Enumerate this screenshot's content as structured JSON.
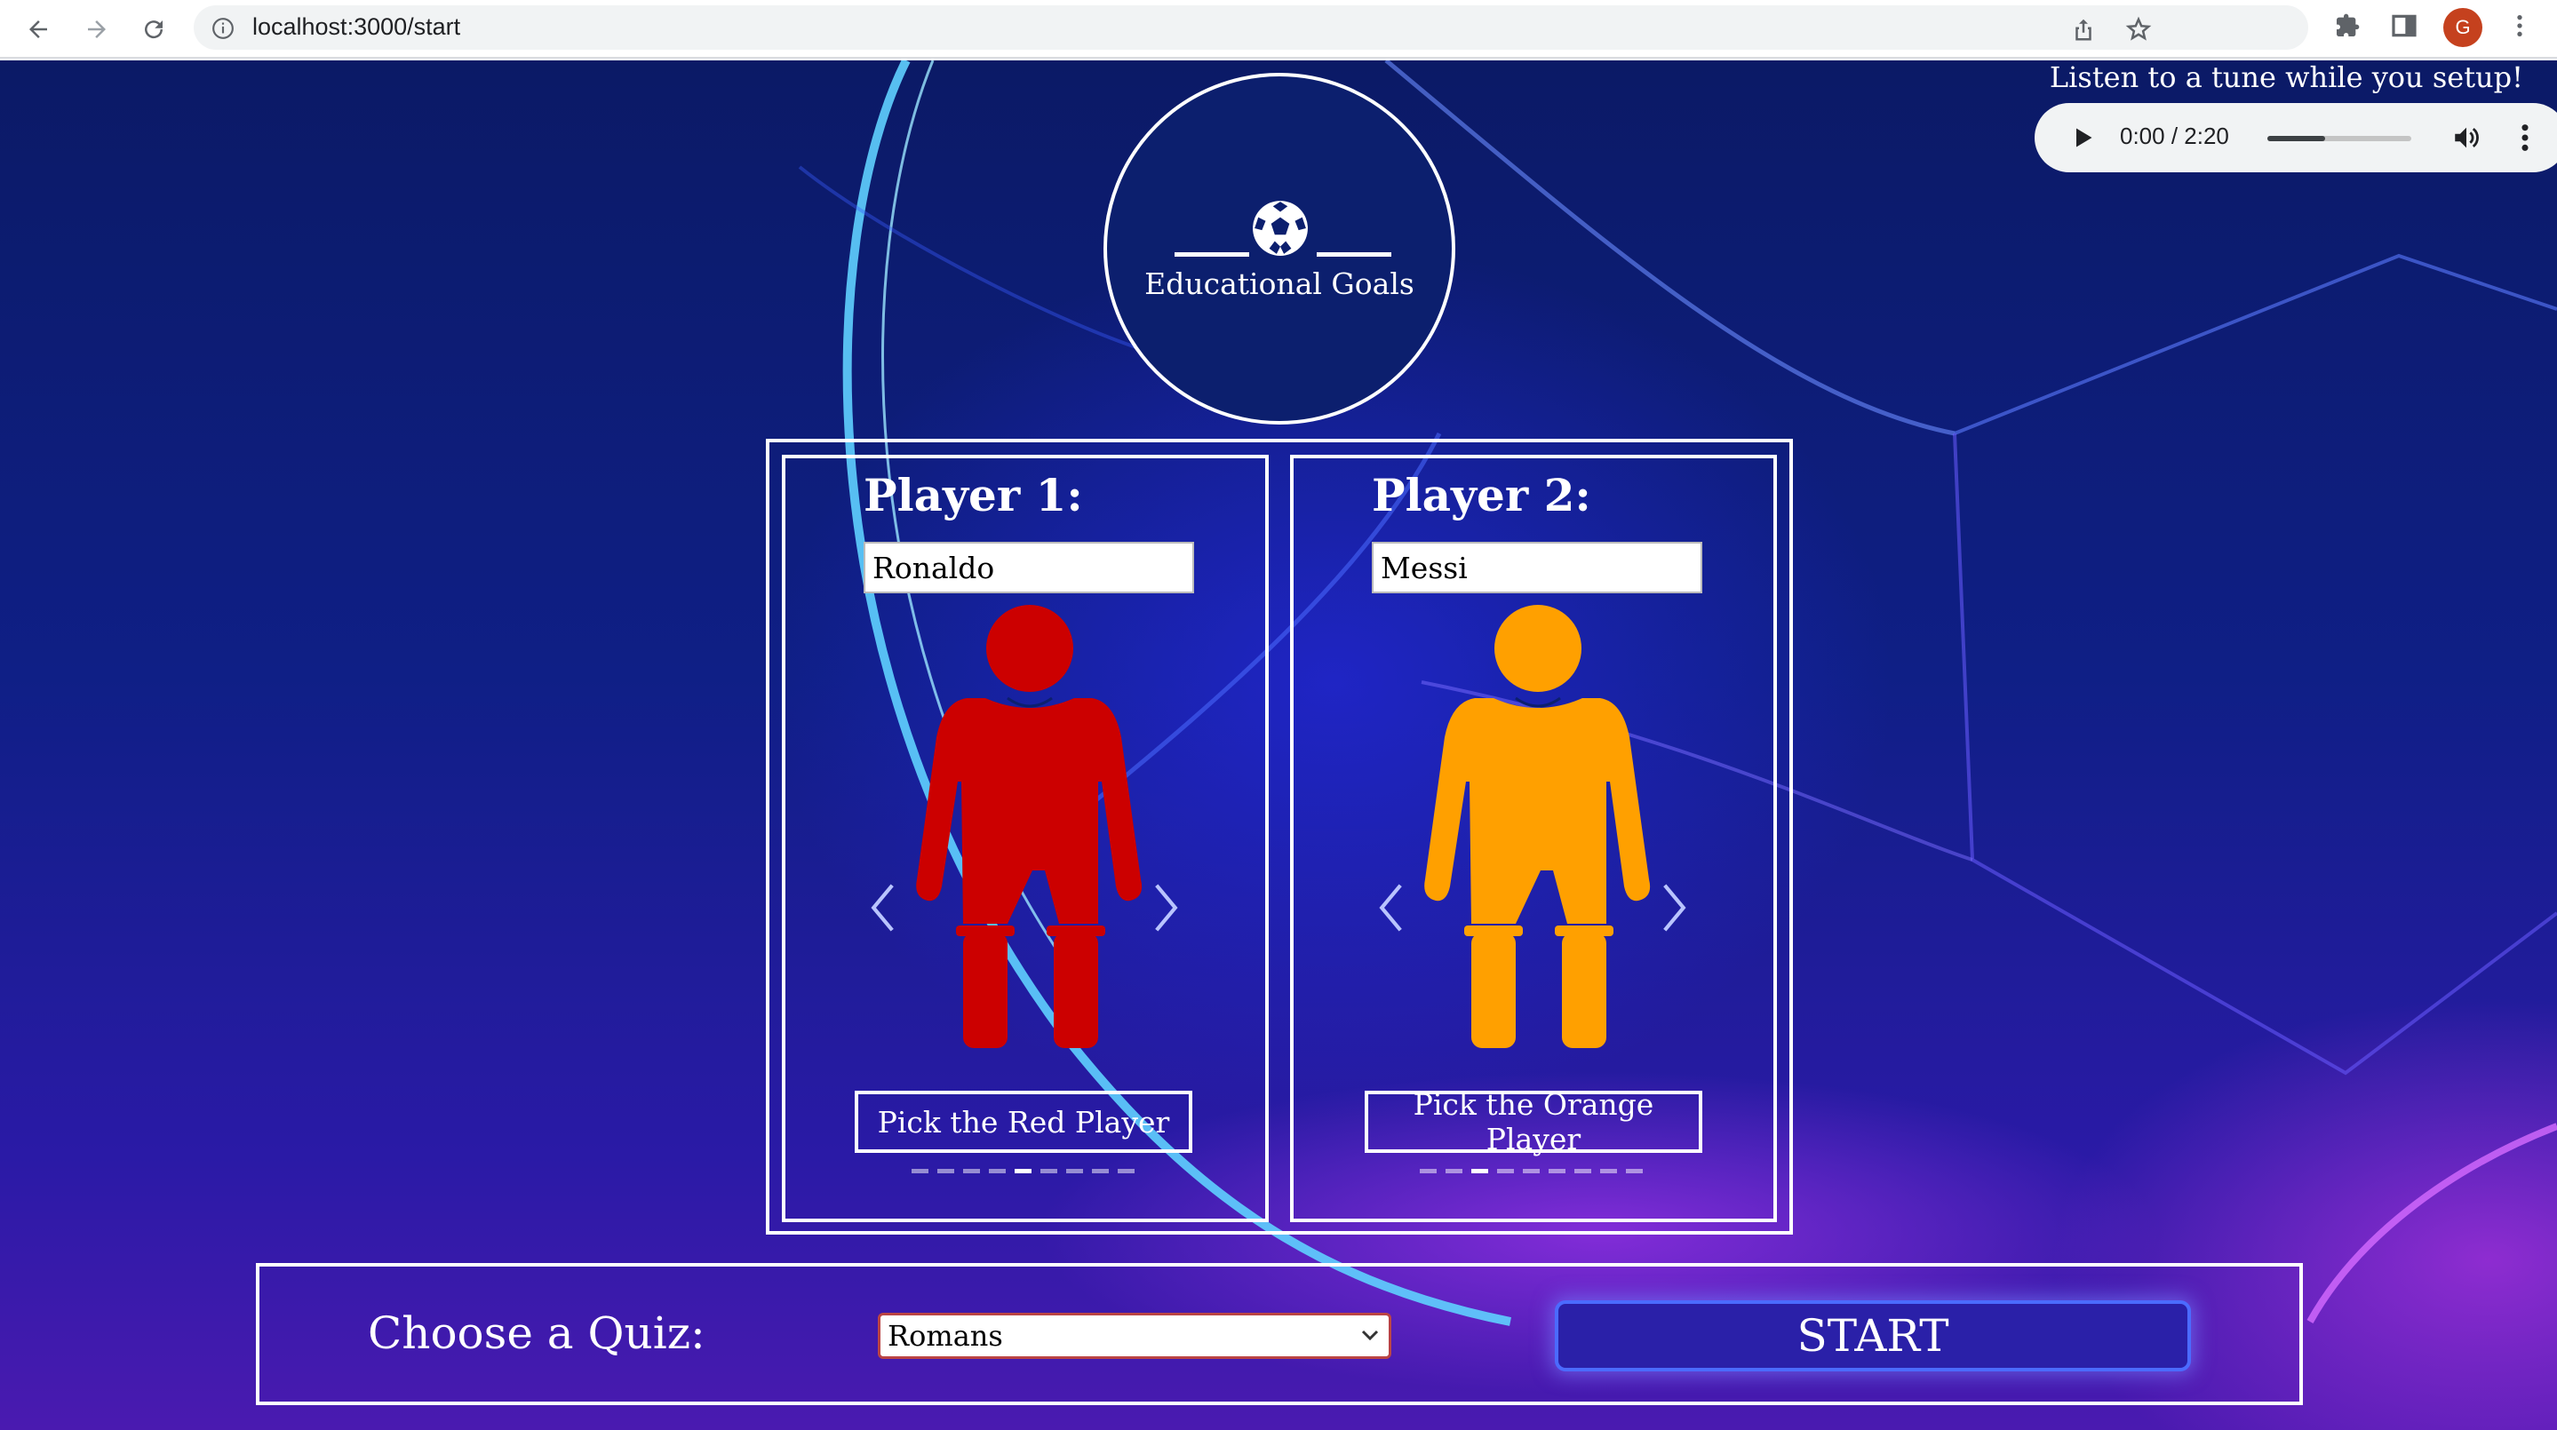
{
  "browser": {
    "url": "localhost:3000/start",
    "avatar_letter": "G"
  },
  "logo": {
    "text": "Educational Goals"
  },
  "audio": {
    "label": "Listen to a tune while you setup!",
    "time": "0:00 / 2:20",
    "progress": 0.4
  },
  "players": [
    {
      "title": "Player 1:",
      "name": "Ronaldo",
      "color": "#cc0000",
      "pick_label": "Pick the Red Player",
      "dot_count": 9,
      "active_dot": 4
    },
    {
      "title": "Player 2:",
      "name": "Messi",
      "color": "#ffa000",
      "pick_label": "Pick the Orange Player",
      "dot_count": 9,
      "active_dot": 2
    }
  ],
  "quiz": {
    "label": "Choose a Quiz:",
    "selected": "Romans",
    "start_label": "START"
  },
  "colors": {
    "accent": "#4b6bff",
    "background": "#0f1f86"
  }
}
